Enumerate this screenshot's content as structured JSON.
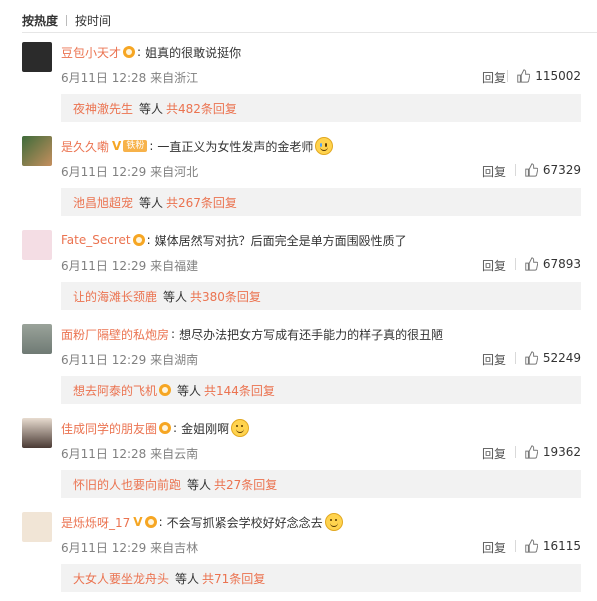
{
  "sort": {
    "hot": "按热度",
    "time": "按时间"
  },
  "comments": [
    {
      "user": "豆包小天才",
      "verified": true,
      "vip": false,
      "fan_badge": "",
      "text": "姐真的很敢说挺你",
      "emoji": "",
      "date": "6月11日 12:28",
      "location": "来自浙江",
      "reply_label": "回复",
      "likes": "115002",
      "thread": {
        "user": "夜神澈先生",
        "verified": false,
        "mid": "等人",
        "count": "共482条回复"
      }
    },
    {
      "user": "是久久嘞",
      "verified": false,
      "vip": true,
      "fan_badge": "铁粉",
      "text": "一直正义为女性发声的金老师",
      "emoji": "cry",
      "date": "6月11日 12:29",
      "location": "来自河北",
      "reply_label": "回复",
      "likes": "67329",
      "thread": {
        "user": "池昌旭超宠",
        "verified": false,
        "mid": "等人",
        "count": "共267条回复"
      }
    },
    {
      "user": "Fate_Secret",
      "verified": true,
      "vip": false,
      "fan_badge": "",
      "text": "媒体居然写对抗？后面完全是单方面围殴性质了",
      "emoji": "",
      "date": "6月11日 12:29",
      "location": "来自福建",
      "reply_label": "回复",
      "likes": "67893",
      "thread": {
        "user": "让的海滩长颈鹿",
        "verified": false,
        "mid": "等人",
        "count": "共380条回复"
      }
    },
    {
      "user": "面粉厂隔壁的私炮房",
      "verified": false,
      "vip": false,
      "fan_badge": "",
      "text": "想尽办法把女方写成有还手能力的样子真的很丑陋",
      "emoji": "",
      "date": "6月11日 12:29",
      "location": "来自湖南",
      "reply_label": "回复",
      "likes": "52249",
      "thread": {
        "user": "想去阿泰的飞机",
        "verified": true,
        "mid": "等人",
        "count": "共144条回复"
      }
    },
    {
      "user": "佳成同学的朋友圈",
      "verified": true,
      "vip": false,
      "fan_badge": "",
      "text": "金姐刚啊",
      "emoji": "smile",
      "date": "6月11日 12:28",
      "location": "来自云南",
      "reply_label": "回复",
      "likes": "19362",
      "thread": {
        "user": "怀旧的人也要向前跑",
        "verified": false,
        "mid": "等人",
        "count": "共27条回复"
      }
    },
    {
      "user": "是烁烁呀_17",
      "verified": true,
      "vip": true,
      "fan_badge": "",
      "text": "不会写抓紧会学校好好念念去",
      "emoji": "smile",
      "date": "6月11日 12:29",
      "location": "来自吉林",
      "reply_label": "回复",
      "likes": "16115",
      "thread": {
        "user": "大女人要坐龙舟头",
        "verified": false,
        "mid": "等人",
        "count": "共71条回复"
      }
    }
  ],
  "colors": {
    "username": "#eb7350",
    "thread_bg": "#f2f2f2",
    "meta": "#808080"
  }
}
